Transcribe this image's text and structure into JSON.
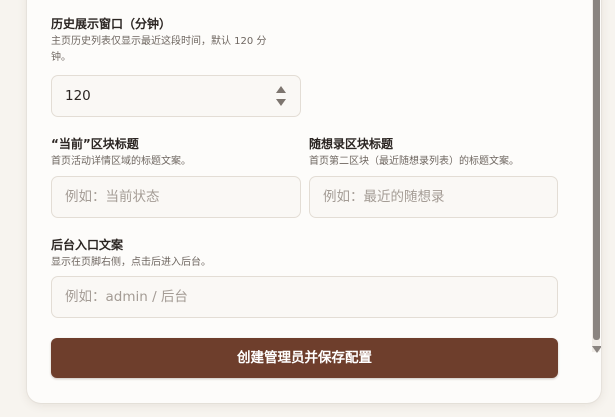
{
  "form": {
    "history_window": {
      "label": "历史展示窗口（分钟）",
      "help_line1": "主页历史列表仅显示最近这段时间，默认 120 分",
      "help_line2": "钟。",
      "value": "120"
    },
    "current_title": {
      "label": "“当前”区块标题",
      "help": "首页活动详情区域的标题文案。",
      "placeholder": "例如：当前状态"
    },
    "notes_title": {
      "label": "随想录区块标题",
      "help": "首页第二区块（最近随想录列表）的标题文案。",
      "placeholder": "例如：最近的随想录"
    },
    "admin_entry": {
      "label": "后台入口文案",
      "help": "显示在页脚右侧，点击后进入后台。",
      "placeholder": "例如：admin / 后台"
    },
    "submit_label": "创建管理员并保存配置"
  },
  "colors": {
    "accent": "#6e3e2c",
    "background": "#f7f4ef",
    "card": "#fdfcfa"
  }
}
